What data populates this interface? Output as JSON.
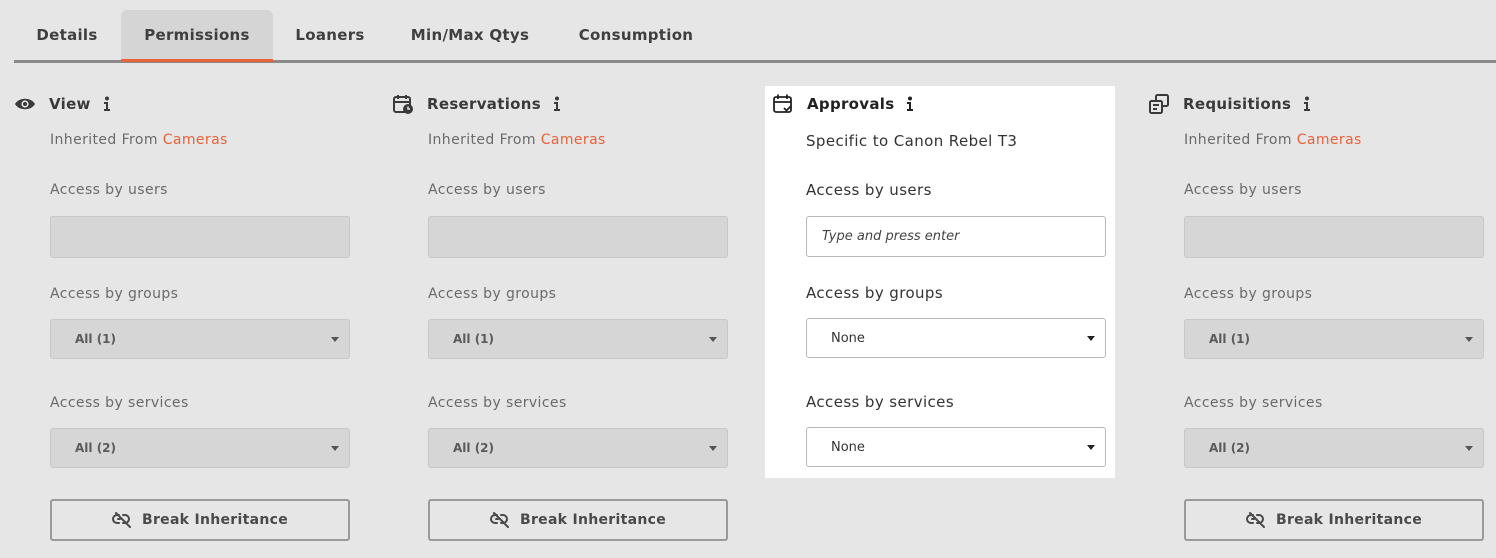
{
  "tabs": [
    {
      "label": "Details"
    },
    {
      "label": "Permissions"
    },
    {
      "label": "Loaners"
    },
    {
      "label": "Min/Max Qtys"
    },
    {
      "label": "Consumption"
    }
  ],
  "active_tab": "Permissions",
  "accent_color": "#e8623a",
  "columns": [
    {
      "title": "View",
      "icon": "eye-icon",
      "inherit_prefix": "Inherited From ",
      "inherit_link": "Cameras",
      "users_label": "Access by users",
      "groups_label": "Access by groups",
      "groups_value": "All (1)",
      "services_label": "Access by services",
      "services_value": "All (2)",
      "button_label": "Break Inheritance"
    },
    {
      "title": "Reservations",
      "icon": "calendar-clock-icon",
      "inherit_prefix": "Inherited From ",
      "inherit_link": "Cameras",
      "users_label": "Access by users",
      "groups_label": "Access by groups",
      "groups_value": "All (1)",
      "services_label": "Access by services",
      "services_value": "All (2)",
      "button_label": "Break Inheritance"
    },
    {
      "title": "Approvals",
      "icon": "calendar-check-icon",
      "specific_text": "Specific to Canon Rebel T3",
      "users_label": "Access by users",
      "users_placeholder": "Type and press enter",
      "groups_label": "Access by groups",
      "groups_value": "None",
      "services_label": "Access by services",
      "services_value": "None"
    },
    {
      "title": "Requisitions",
      "icon": "requisition-icon",
      "inherit_prefix": "Inherited From ",
      "inherit_link": "Cameras",
      "users_label": "Access by users",
      "groups_label": "Access by groups",
      "groups_value": "All (1)",
      "services_label": "Access by services",
      "services_value": "All (2)",
      "button_label": "Break Inheritance"
    }
  ]
}
